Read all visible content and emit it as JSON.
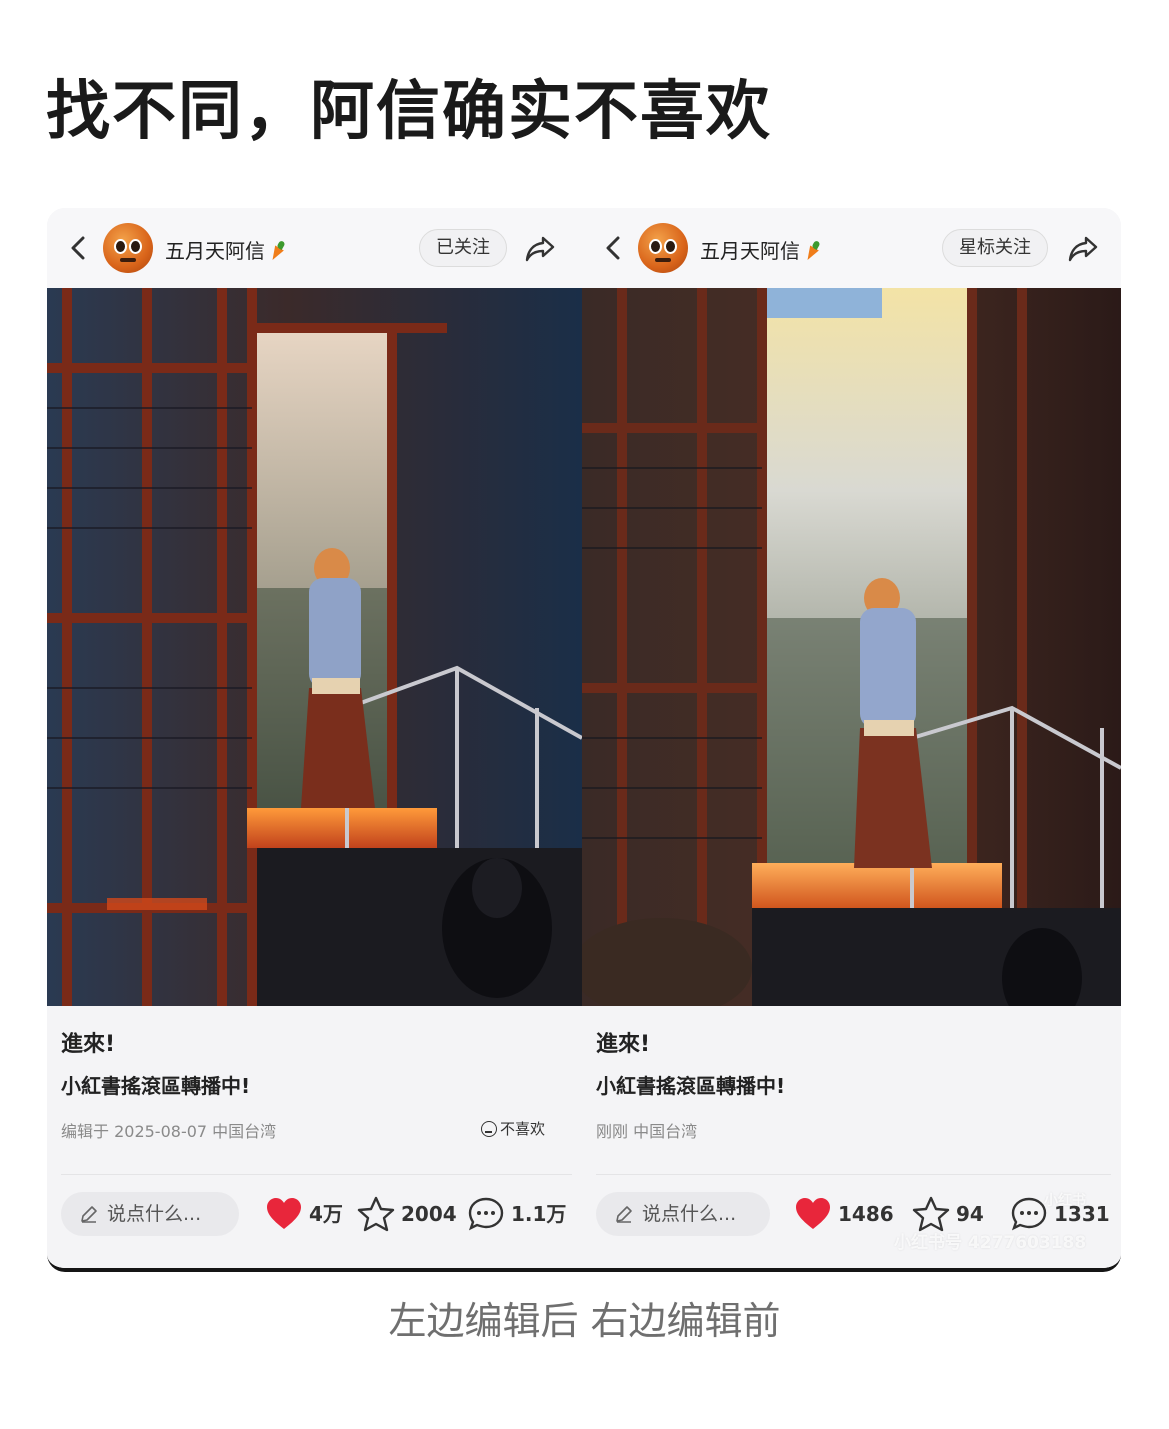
{
  "headline": "找不同，阿信确实不喜欢",
  "caption": "左边编辑后 右边编辑前",
  "panels": {
    "left": {
      "username": "五月天阿信",
      "follow_label": "已关注",
      "post_title": "進來!",
      "post_body": "小紅書搖滾區轉播中!",
      "meta": "编辑于 2025-08-07 中国台湾",
      "dislike_label": "不喜欢",
      "comment_placeholder": "说点什么...",
      "likes": "4万",
      "stars": "2004",
      "comments": "1.1万"
    },
    "right": {
      "username": "五月天阿信",
      "follow_label": "星标关注",
      "post_title": "進來!",
      "post_body": "小紅書搖滾區轉播中!",
      "meta": "刚刚 中国台湾",
      "comment_placeholder": "说点什么...",
      "likes": "1486",
      "stars": "94",
      "comments": "1331",
      "watermark_logo": "小红书",
      "watermark_id": "小红书号 4277603188"
    }
  },
  "colors": {
    "like_heart": "#e8263b",
    "background": "#ffffff",
    "panel_bg": "#f4f4f6"
  },
  "icons": [
    "back-arrow-icon",
    "share-icon",
    "heart-icon",
    "star-icon",
    "comment-bubble-icon",
    "pencil-icon",
    "dislike-face-icon",
    "carrot-icon"
  ]
}
